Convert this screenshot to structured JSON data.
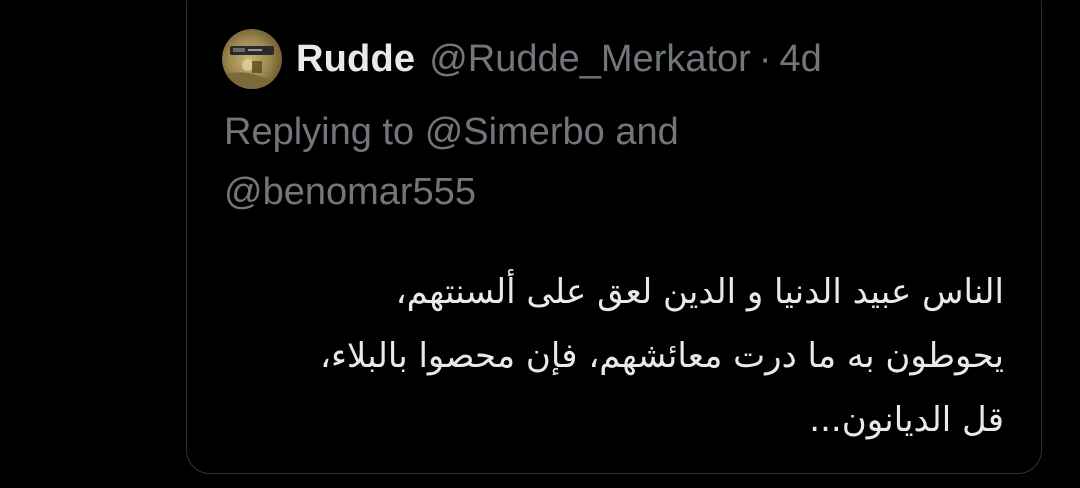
{
  "tweet": {
    "author_name": "Rudde",
    "author_handle": "@Rudde_Merkator",
    "separator": "·",
    "timestamp": "4d",
    "reply_prefix": "Replying to",
    "reply_mention_1": "@Simerbo",
    "reply_and": "and",
    "reply_mention_2": "@benomar555",
    "body_lines": [
      "الناس عبيد الدنيا و الدين لعق على ألسنتهم،",
      "يحوطون به ما درت معائشهم، فإن محصوا بالبلاء،",
      "قل الديانون..."
    ]
  },
  "colors": {
    "background": "#000000",
    "primary_text": "#e7e9ea",
    "secondary_text": "#71767b",
    "border": "#2f3336"
  }
}
